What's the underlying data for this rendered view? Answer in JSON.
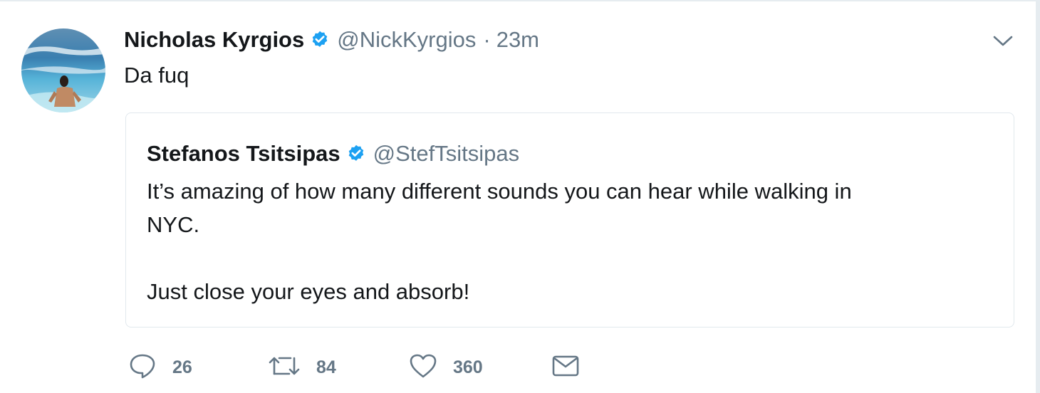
{
  "tweet": {
    "author": {
      "name": "Nicholas Kyrgios",
      "handle": "@NickKyrgios",
      "verified": true
    },
    "separator": "·",
    "time": "23m",
    "text": "Da fuq",
    "quoted": {
      "author": {
        "name": "Stefanos Tsitsipas",
        "handle": "@StefTsitsipas",
        "verified": true
      },
      "lines": [
        "It’s amazing of how many different sounds you can hear while walking in",
        "NYC.",
        "",
        "Just close your eyes and absorb!"
      ]
    },
    "actions": {
      "replies": "26",
      "retweets": "84",
      "likes": "360"
    }
  },
  "colors": {
    "text": "#14171a",
    "secondary": "#657786",
    "verified": "#1da1f2",
    "border": "#e1e8ed"
  },
  "icons": [
    "verified-badge-icon",
    "chevron-down-icon",
    "reply-icon",
    "retweet-icon",
    "like-icon",
    "direct-message-icon"
  ]
}
